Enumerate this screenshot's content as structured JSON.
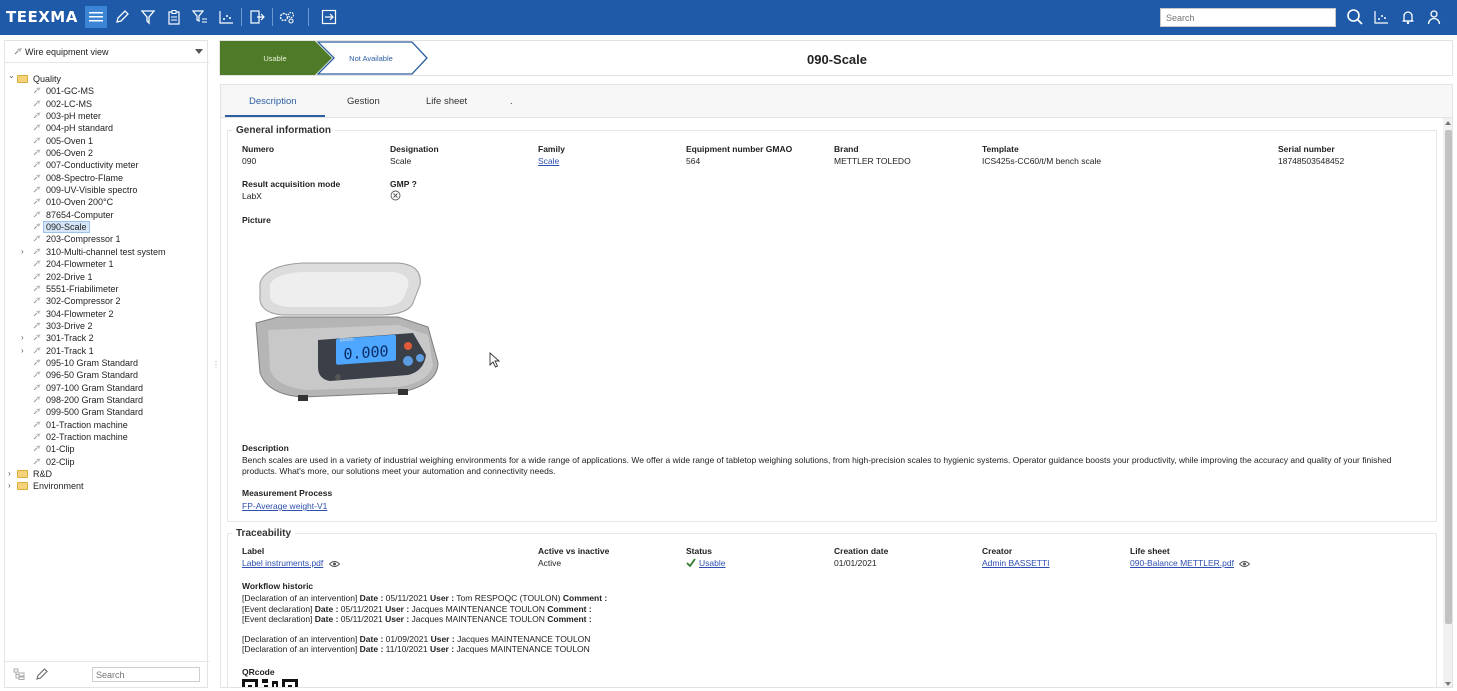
{
  "topbar": {
    "logo": "TEEXMA",
    "search_placeholder": "Search",
    "icons": [
      "menu-icon",
      "pencil-icon",
      "filter-icon",
      "clipboard-icon",
      "filter-list-icon",
      "chart-icon",
      "export-icon",
      "settings-group-icon",
      "exit-icon"
    ],
    "right_icons": [
      "search-icon",
      "chart-icon",
      "bell-icon",
      "user-icon"
    ],
    "accent": "#1e5aa8"
  },
  "left": {
    "view_label": "Wire equipment view",
    "search_placeholder": "Search",
    "tree": [
      {
        "label": "Quality",
        "type": "folder",
        "expanded": true,
        "depth": 0
      },
      {
        "label": "001-GC-MS",
        "type": "leaf",
        "depth": 1
      },
      {
        "label": "002-LC-MS",
        "type": "leaf",
        "depth": 1
      },
      {
        "label": "003-pH meter",
        "type": "leaf",
        "depth": 1
      },
      {
        "label": "004-pH standard",
        "type": "leaf",
        "depth": 1
      },
      {
        "label": "005-Oven 1",
        "type": "leaf",
        "depth": 1
      },
      {
        "label": "006-Oven 2",
        "type": "leaf",
        "depth": 1
      },
      {
        "label": "007-Conductivity meter",
        "type": "leaf",
        "depth": 1
      },
      {
        "label": "008-Spectro-Flame",
        "type": "leaf",
        "depth": 1
      },
      {
        "label": "009-UV-Visible spectro",
        "type": "leaf",
        "depth": 1
      },
      {
        "label": "010-Oven 200°C",
        "type": "leaf",
        "depth": 1
      },
      {
        "label": "87654-Computer",
        "type": "leaf",
        "depth": 1
      },
      {
        "label": "090-Scale",
        "type": "leaf",
        "depth": 1,
        "selected": true
      },
      {
        "label": "203-Compressor 1",
        "type": "leaf",
        "depth": 1
      },
      {
        "label": "310-Multi-channel test system",
        "type": "leaf",
        "depth": 1,
        "expandable": true
      },
      {
        "label": "204-Flowmeter 1",
        "type": "leaf",
        "depth": 1
      },
      {
        "label": "202-Drive 1",
        "type": "leaf",
        "depth": 1
      },
      {
        "label": "5551-Friabilimeter",
        "type": "leaf",
        "depth": 1
      },
      {
        "label": "302-Compressor 2",
        "type": "leaf",
        "depth": 1
      },
      {
        "label": "304-Flowmeter 2",
        "type": "leaf",
        "depth": 1
      },
      {
        "label": "303-Drive 2",
        "type": "leaf",
        "depth": 1
      },
      {
        "label": "301-Track 2",
        "type": "leaf",
        "depth": 1,
        "expandable": true
      },
      {
        "label": "201-Track 1",
        "type": "leaf",
        "depth": 1,
        "expandable": true
      },
      {
        "label": "095-10 Gram Standard",
        "type": "leaf",
        "depth": 1
      },
      {
        "label": "096-50 Gram Standard",
        "type": "leaf",
        "depth": 1
      },
      {
        "label": "097-100 Gram Standard",
        "type": "leaf",
        "depth": 1
      },
      {
        "label": "098-200 Gram Standard",
        "type": "leaf",
        "depth": 1
      },
      {
        "label": "099-500 Gram Standard",
        "type": "leaf",
        "depth": 1
      },
      {
        "label": "01-Traction machine",
        "type": "leaf",
        "depth": 1
      },
      {
        "label": "02-Traction machine",
        "type": "leaf",
        "depth": 1
      },
      {
        "label": "01-Clip",
        "type": "leaf",
        "depth": 1
      },
      {
        "label": "02-Clip",
        "type": "leaf",
        "depth": 1
      },
      {
        "label": "R&D",
        "type": "folder",
        "expanded": false,
        "depth": 0
      },
      {
        "label": "Environment",
        "type": "folder",
        "expanded": false,
        "depth": 0
      }
    ]
  },
  "header": {
    "steps": [
      {
        "label": "Usable",
        "active": true,
        "color": "#4f7a28"
      },
      {
        "label": "Not Available",
        "active": false
      }
    ],
    "title": "090-Scale"
  },
  "tabs": [
    {
      "label": "Description",
      "active": true
    },
    {
      "label": "Gestion"
    },
    {
      "label": "Life sheet"
    },
    {
      "label": "."
    }
  ],
  "general": {
    "title": "General information",
    "fields_row1": [
      {
        "label": "Numero",
        "value": "090"
      },
      {
        "label": "Designation",
        "value": "Scale"
      },
      {
        "label": "Family",
        "value": "Scale",
        "link": true
      },
      {
        "label": "Equipment number GMAO",
        "value": "564"
      },
      {
        "label": "Brand",
        "value": "METTLER TOLEDO"
      },
      {
        "label": "Template",
        "value": "ICS425s-CC60/t/M bench scale"
      },
      {
        "label": "Serial number",
        "value": "18748503548452"
      }
    ],
    "fields_row2": [
      {
        "label": "Result acquisition mode",
        "value": "LabX"
      },
      {
        "label": "GMP ?",
        "value": ""
      }
    ],
    "picture_label": "Picture",
    "scale_display": "0.000",
    "scale_brand": "gastro",
    "description_label": "Description",
    "description": "Bench scales are used in a variety of industrial weighing environments for a wide range of applications. We offer a wide range of tabletop weighing solutions, from high-precision scales to hygienic systems. Operator guidance boosts your productivity, while improving the accuracy and quality of your finished products. What's more, our solutions meet your automation and connectivity needs.",
    "measurement_label": "Measurement Process",
    "measurement_value": "FP-Average weight-V1"
  },
  "traceability": {
    "title": "Traceability",
    "fields": [
      {
        "label": "Label",
        "value": "Label instruments.pdf",
        "link": true,
        "eye": true
      },
      {
        "label": "Active vs inactive",
        "value": "Active"
      },
      {
        "label": "Status",
        "value": "Usable",
        "link": true,
        "check": true
      },
      {
        "label": "Creation date",
        "value": "01/01/2021"
      },
      {
        "label": "Creator",
        "value": "Admin BASSETTI",
        "link": true
      },
      {
        "label": "Life sheet",
        "value": "090-Balance METTLER.pdf",
        "link": true,
        "eye": true
      }
    ],
    "workflow_label": "Workflow historic",
    "history": [
      {
        "event": "[Declaration of an intervention]",
        "date": "05/11/2021",
        "user": "Tom RESPOQC (TOULON)",
        "comment": true
      },
      {
        "event": "[Event declaration]",
        "date": "05/11/2021",
        "user": "Jacques MAINTENANCE TOULON",
        "comment": true
      },
      {
        "event": "[Event declaration]",
        "date": "05/11/2021",
        "user": "Jacques MAINTENANCE TOULON",
        "comment": true
      },
      {
        "event": "[Declaration of an intervention]",
        "date": "01/09/2021",
        "user": "Jacques MAINTENANCE TOULON",
        "comment": false
      },
      {
        "event": "[Declaration of an intervention]",
        "date": "11/10/2021",
        "user": "Jacques MAINTENANCE TOULON",
        "comment": false
      }
    ],
    "history_keys": {
      "date": "Date :",
      "user": "User :",
      "comment": "Comment :"
    },
    "qrcode_label": "QRcode"
  }
}
